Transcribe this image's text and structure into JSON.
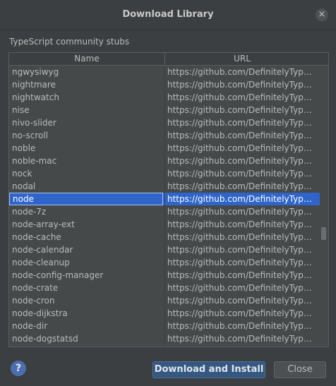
{
  "dialog": {
    "title": "Download Library",
    "close_icon": "×"
  },
  "section_label": "TypeScript community stubs",
  "table": {
    "columns": [
      "Name",
      "URL"
    ],
    "rows": [
      {
        "name": "ngwysiwyg",
        "url": "https://github.com/DefinitelyTyped/..."
      },
      {
        "name": "nightmare",
        "url": "https://github.com/DefinitelyTyped/..."
      },
      {
        "name": "nightwatch",
        "url": "https://github.com/DefinitelyTyped/..."
      },
      {
        "name": "nise",
        "url": "https://github.com/DefinitelyTyped/..."
      },
      {
        "name": "nivo-slider",
        "url": "https://github.com/DefinitelyTyped/..."
      },
      {
        "name": "no-scroll",
        "url": "https://github.com/DefinitelyTyped/..."
      },
      {
        "name": "noble",
        "url": "https://github.com/DefinitelyTyped/..."
      },
      {
        "name": "noble-mac",
        "url": "https://github.com/DefinitelyTyped/..."
      },
      {
        "name": "nock",
        "url": "https://github.com/DefinitelyTyped/..."
      },
      {
        "name": "nodal",
        "url": "https://github.com/DefinitelyTyped/..."
      },
      {
        "name": "node",
        "url": "https://github.com/DefinitelyTyped/..."
      },
      {
        "name": "node-7z",
        "url": "https://github.com/DefinitelyTyped/..."
      },
      {
        "name": "node-array-ext",
        "url": "https://github.com/DefinitelyTyped/..."
      },
      {
        "name": "node-cache",
        "url": "https://github.com/DefinitelyTyped/..."
      },
      {
        "name": "node-calendar",
        "url": "https://github.com/DefinitelyTyped/..."
      },
      {
        "name": "node-cleanup",
        "url": "https://github.com/DefinitelyTyped/..."
      },
      {
        "name": "node-config-manager",
        "url": "https://github.com/DefinitelyTyped/..."
      },
      {
        "name": "node-crate",
        "url": "https://github.com/DefinitelyTyped/..."
      },
      {
        "name": "node-cron",
        "url": "https://github.com/DefinitelyTyped/..."
      },
      {
        "name": "node-dijkstra",
        "url": "https://github.com/DefinitelyTyped/..."
      },
      {
        "name": "node-dir",
        "url": "https://github.com/DefinitelyTyped/..."
      },
      {
        "name": "node-dogstatsd",
        "url": "https://github.com/DefinitelyTyped/..."
      }
    ],
    "selected_name": "node"
  },
  "footer": {
    "help_icon": "?",
    "primary_label": "Download and Install",
    "secondary_label": "Close"
  }
}
